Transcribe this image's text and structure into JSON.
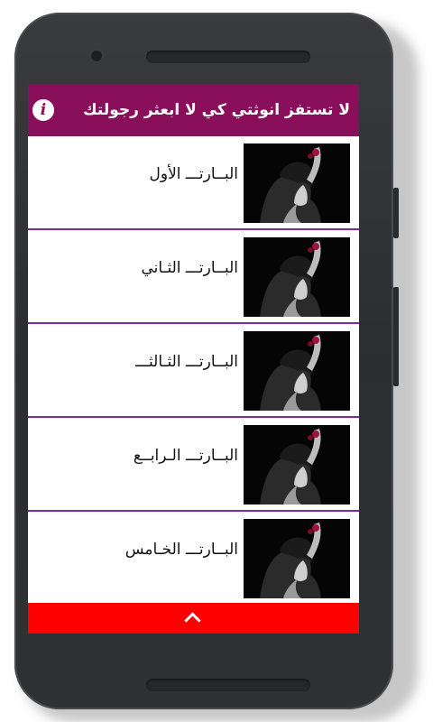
{
  "app_bar": {
    "title": "لا تستفز انوثتي كي لا ابعثر رجولتك",
    "info_icon": "info-icon",
    "color": "#8a0f5a"
  },
  "list": {
    "divider_color": "#7a2aa8",
    "items": [
      {
        "label": "البــارتـــ الأول",
        "thumbnail": "woman-portrait-thumbnail"
      },
      {
        "label": "البــارتـــ الثـاني",
        "thumbnail": "woman-portrait-thumbnail"
      },
      {
        "label": "البــارتـــ الثـالثـــ",
        "thumbnail": "woman-portrait-thumbnail"
      },
      {
        "label": "البــارتـــ الـرابــع",
        "thumbnail": "woman-portrait-thumbnail"
      },
      {
        "label": "البــارتـــ الخـامس",
        "thumbnail": "woman-portrait-thumbnail"
      }
    ]
  },
  "bottom_bar": {
    "icon": "chevron-up-icon",
    "color": "#ff0000"
  }
}
